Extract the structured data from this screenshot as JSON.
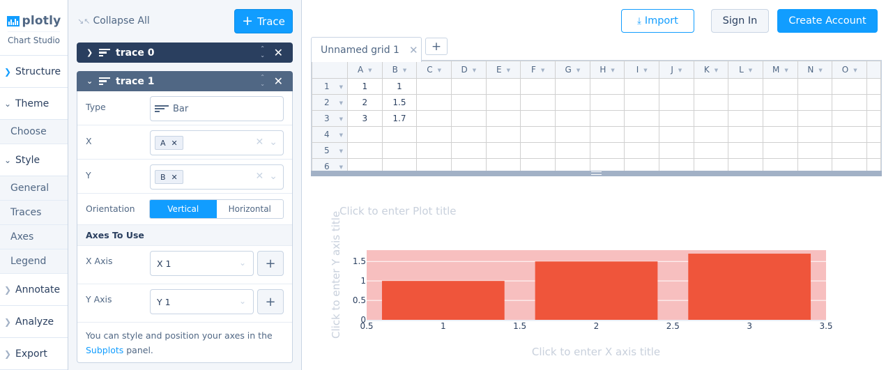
{
  "nav": {
    "logo_text": "plotly",
    "logo_sub": "Chart Studio",
    "items": [
      {
        "label": "Structure",
        "type": "group",
        "state": "active"
      },
      {
        "label": "Theme",
        "type": "group",
        "state": "expanded"
      },
      {
        "label": "Choose",
        "type": "sub"
      },
      {
        "label": "Style",
        "type": "group",
        "state": "expanded"
      },
      {
        "label": "General",
        "type": "sub"
      },
      {
        "label": "Traces",
        "type": "sub"
      },
      {
        "label": "Axes",
        "type": "sub"
      },
      {
        "label": "Legend",
        "type": "sub"
      },
      {
        "label": "Annotate",
        "type": "group",
        "state": "collapsed"
      },
      {
        "label": "Analyze",
        "type": "group",
        "state": "collapsed"
      },
      {
        "label": "Export",
        "type": "group",
        "state": "collapsed"
      }
    ]
  },
  "panel": {
    "collapse_all": "Collapse All",
    "add_trace": "Trace",
    "traces": [
      {
        "name": "trace 0",
        "expanded": false
      },
      {
        "name": "trace 1",
        "expanded": true
      }
    ],
    "fields": {
      "type_label": "Type",
      "type_value": "Bar",
      "x_label": "X",
      "x_chip": "A",
      "y_label": "Y",
      "y_chip": "B",
      "orientation_label": "Orientation",
      "orientation_options": [
        "Vertical",
        "Horizontal"
      ],
      "orientation_selected": "Vertical",
      "axes_section": "Axes To Use",
      "x_axis_label": "X Axis",
      "x_axis_value": "X 1",
      "y_axis_label": "Y Axis",
      "y_axis_value": "Y 1",
      "note_text": "You can style and position your axes in the",
      "note_link": "Subplots",
      "note_suffix": "panel."
    }
  },
  "topbar": {
    "import": "Import",
    "sign_in": "Sign In",
    "create_account": "Create Account"
  },
  "grid": {
    "tab_name": "Unnamed grid 1",
    "columns": [
      "A",
      "B",
      "C",
      "D",
      "E",
      "F",
      "G",
      "H",
      "I",
      "J",
      "K",
      "L",
      "M",
      "N",
      "O"
    ],
    "rows": [
      {
        "n": "1",
        "cells": [
          "1",
          "1"
        ]
      },
      {
        "n": "2",
        "cells": [
          "2",
          "1.5"
        ]
      },
      {
        "n": "3",
        "cells": [
          "3",
          "1.7"
        ]
      },
      {
        "n": "4",
        "cells": []
      },
      {
        "n": "5",
        "cells": []
      },
      {
        "n": "6",
        "cells": []
      }
    ]
  },
  "colors": {
    "accent": "#119dff",
    "bar": "#ef553b",
    "plot_bg": "#f7bfbf",
    "nav_dark": "#2a3f5f",
    "nav_mid": "#506784"
  },
  "chart_data": {
    "type": "bar",
    "title": "Click to enter Plot title",
    "xlabel": "Click to enter X axis title",
    "ylabel": "Click to enter Y axis title",
    "x": [
      1,
      2,
      3
    ],
    "values": [
      1,
      1.5,
      1.7
    ],
    "series": [
      {
        "name": "trace 1",
        "x": [
          1,
          2,
          3
        ],
        "values": [
          1,
          1.5,
          1.7
        ]
      }
    ],
    "xlim": [
      0.5,
      3.5
    ],
    "ylim": [
      0,
      1.79
    ],
    "xticks": [
      "0.5",
      "1",
      "1.5",
      "2",
      "2.5",
      "3",
      "3.5"
    ],
    "xtick_values": [
      0.5,
      1,
      1.5,
      2,
      2.5,
      3,
      3.5
    ],
    "yticks": [
      "0",
      "0.5",
      "1",
      "1.5"
    ],
    "ytick_values": [
      0,
      0.5,
      1,
      1.5
    ],
    "bar_width": 0.8,
    "grid": true,
    "legend": "none"
  }
}
